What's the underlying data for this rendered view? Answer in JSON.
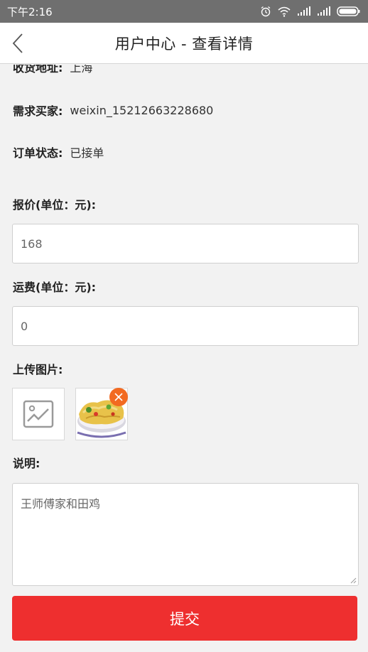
{
  "status_bar": {
    "time": "下午2:16",
    "icons": [
      "alarm-icon",
      "wifi-icon",
      "signal-icon",
      "signal-icon",
      "battery-icon"
    ]
  },
  "navbar": {
    "title": "用户中心 - 查看详情",
    "back_icon": "chevron-left-icon"
  },
  "details": {
    "address_label": "收货地址:",
    "address_value": "上海",
    "buyer_label": "需求买家:",
    "buyer_value": "weixin_15212663228680",
    "status_label": "订单状态:",
    "status_value": "已接单"
  },
  "form": {
    "price_label": "报价(单位：元):",
    "price_value": "168",
    "shipping_label": "运费(单位：元):",
    "shipping_value": "0",
    "upload_label": "上传图片:",
    "description_label": "说明:",
    "description_value": "王师傅家和田鸡"
  },
  "submit_label": "提交",
  "colors": {
    "accent": "#ee2f2f",
    "remove_badge": "#f26a21",
    "status_bar": "#6f6f6f",
    "background": "#f2f2f2"
  }
}
